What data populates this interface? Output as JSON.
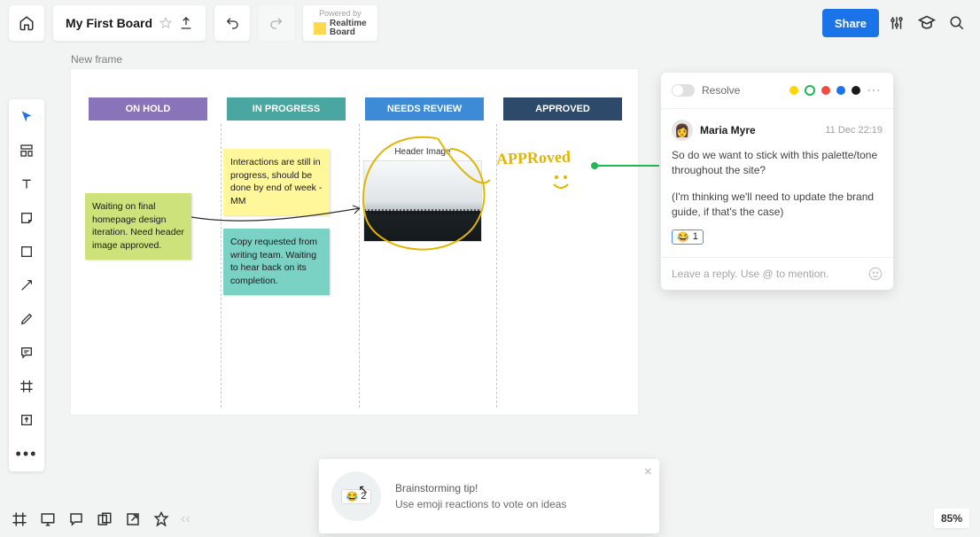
{
  "header": {
    "board_title": "My First Board",
    "powered_by_label": "Powered by",
    "powered_by_brand": "Realtime\nBoard",
    "share_label": "Share"
  },
  "frame": {
    "label": "New frame"
  },
  "columns": [
    {
      "label": "ON HOLD",
      "color": "#8a74b9"
    },
    {
      "label": "IN PROGRESS",
      "color": "#4aa6a0"
    },
    {
      "label": "NEEDS REVIEW",
      "color": "#3d8bd6"
    },
    {
      "label": "APPROVED",
      "color": "#2d4a6b"
    }
  ],
  "stickies": {
    "hold1": "Waiting on final homepage design iteration. Need header image approved.",
    "prog1": "Interactions are still in progress, should be done by end of week - MM",
    "prog2": "Copy requested from writing team. Waiting to hear back on its completion."
  },
  "header_image_caption": "Header Image",
  "handwriting": "APPRoved",
  "comment": {
    "resolve_label": "Resolve",
    "palette": [
      "#ffd500",
      "#1fb855",
      "#f04b3e",
      "#1a73e8",
      "#1a1a1a"
    ],
    "author": "Maria Myre",
    "timestamp": "11 Dec 22:19",
    "message_1": "So do we want to stick with this palette/tone throughout the site?",
    "message_2": "(I'm thinking we'll need to update the brand guide, if that's the case)",
    "reaction_emoji": "😂",
    "reaction_count": "1",
    "reply_placeholder": "Leave a reply. Use @ to mention."
  },
  "tip": {
    "line1": "Brainstorming tip!",
    "line2": "Use emoji reactions to vote on ideas",
    "pill_emoji": "😂",
    "pill_count": "2"
  },
  "zoom": "85%"
}
